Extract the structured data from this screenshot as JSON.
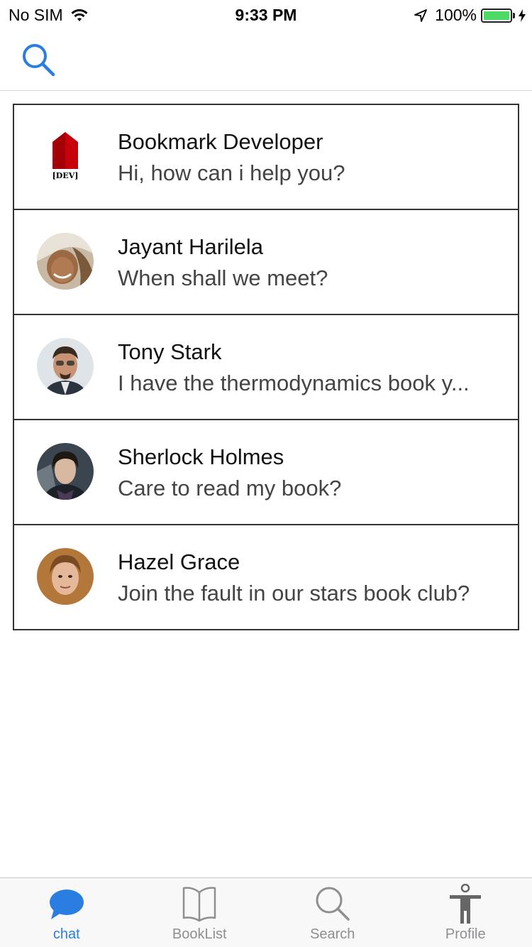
{
  "status_bar": {
    "carrier": "No SIM",
    "time": "9:33 PM",
    "battery": "100%"
  },
  "nav": {
    "search_icon": "search-icon"
  },
  "chats": [
    {
      "name": "Bookmark Developer",
      "message": "Hi, how can i help you?",
      "avatar_text": "[DEV]"
    },
    {
      "name": "Jayant Harilela",
      "message": "When shall we meet?"
    },
    {
      "name": "Tony Stark",
      "message": "I have the thermodynamics book y..."
    },
    {
      "name": "Sherlock Holmes",
      "message": "Care to read my book?"
    },
    {
      "name": "Hazel Grace",
      "message": "Join the fault in our stars book club?"
    }
  ],
  "tabs": [
    {
      "label": "chat",
      "icon": "chat-bubble-icon",
      "active": true
    },
    {
      "label": "BookList",
      "icon": "book-icon",
      "active": false
    },
    {
      "label": "Search",
      "icon": "search-icon",
      "active": false
    },
    {
      "label": "Profile",
      "icon": "person-icon",
      "active": false
    }
  ],
  "colors": {
    "accent": "#2a7de1",
    "battery": "#4cd964",
    "inactive_tab": "#8e8e93"
  }
}
